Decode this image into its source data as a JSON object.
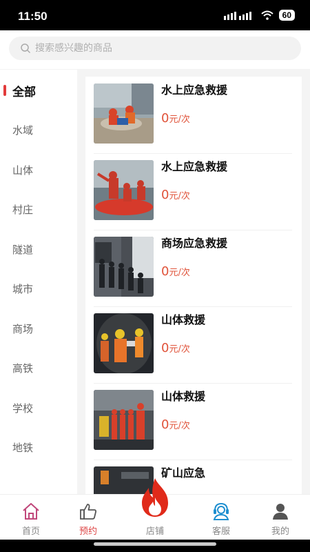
{
  "status": {
    "time": "11:50",
    "battery": "60"
  },
  "search": {
    "placeholder": "搜索感兴趣的商品"
  },
  "sidebar": {
    "items": [
      {
        "label": "全部",
        "active": true
      },
      {
        "label": "水域"
      },
      {
        "label": "山体"
      },
      {
        "label": "村庄"
      },
      {
        "label": "隧道"
      },
      {
        "label": "城市"
      },
      {
        "label": "商场"
      },
      {
        "label": "高铁"
      },
      {
        "label": "学校"
      },
      {
        "label": "地铁"
      }
    ]
  },
  "products": [
    {
      "title": "水上应急救援",
      "price": "0",
      "unit": "元/次"
    },
    {
      "title": "水上应急救援",
      "price": "0",
      "unit": "元/次"
    },
    {
      "title": "商场应急救援",
      "price": "0",
      "unit": "元/次"
    },
    {
      "title": "山体救援",
      "price": "0",
      "unit": "元/次"
    },
    {
      "title": "山体救援",
      "price": "0",
      "unit": "元/次"
    },
    {
      "title": "矿山应急",
      "price": "",
      "unit": ""
    }
  ],
  "tabbar": {
    "items": [
      {
        "label": "首页",
        "icon": "home-icon"
      },
      {
        "label": "预约",
        "icon": "thumbs-up-icon",
        "active": true
      },
      {
        "label": "店铺",
        "icon": "fire-icon"
      },
      {
        "label": "客服",
        "icon": "customer-service-icon"
      },
      {
        "label": "我的",
        "icon": "user-icon"
      }
    ]
  },
  "colors": {
    "accent": "#e23b3b",
    "price": "#e0533a",
    "active_tab": "#d44"
  }
}
